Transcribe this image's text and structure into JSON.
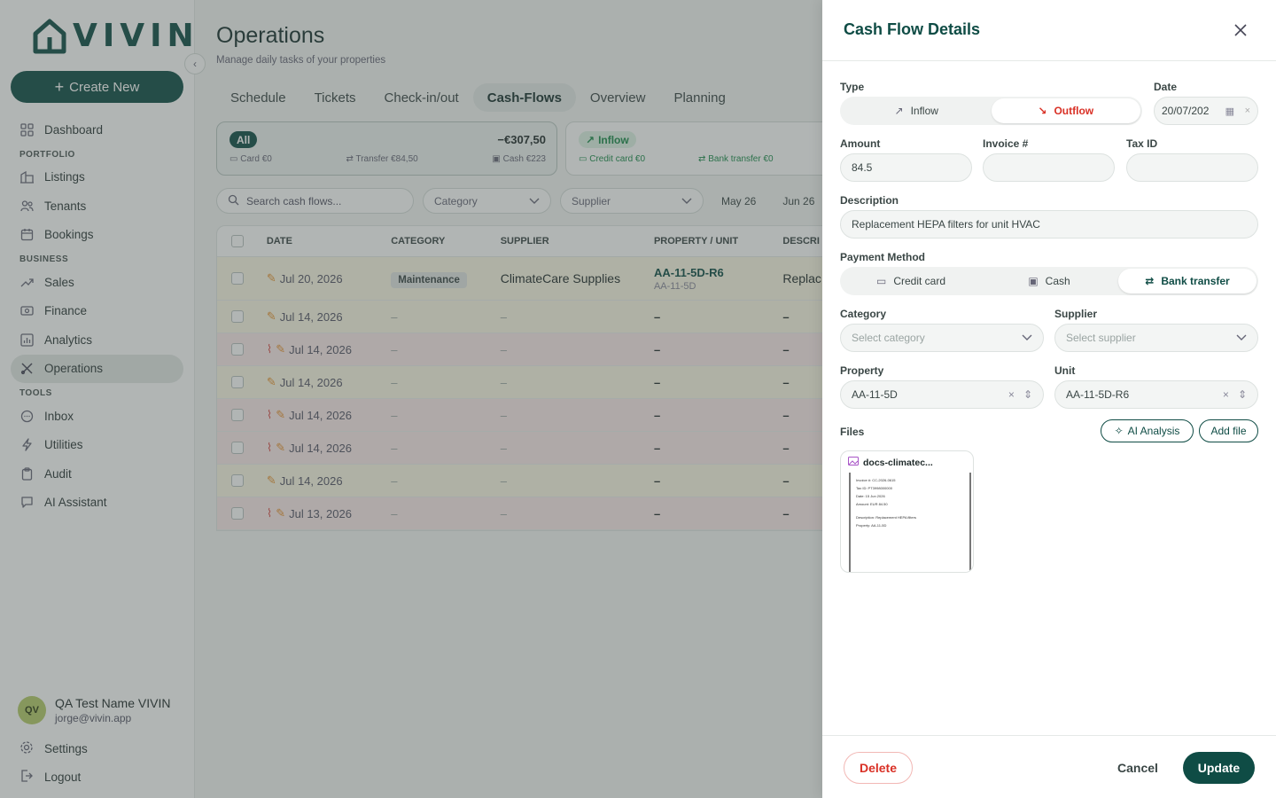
{
  "brand": {
    "name": "VIVIN"
  },
  "sidebar": {
    "create_label": "Create New",
    "items": [
      {
        "label": "Dashboard"
      },
      {
        "section": "PORTFOLIO"
      },
      {
        "label": "Listings"
      },
      {
        "label": "Tenants"
      },
      {
        "label": "Bookings"
      },
      {
        "section": "BUSINESS"
      },
      {
        "label": "Sales"
      },
      {
        "label": "Finance"
      },
      {
        "label": "Analytics"
      },
      {
        "label": "Operations"
      },
      {
        "section": "TOOLS"
      },
      {
        "label": "Inbox"
      },
      {
        "label": "Utilities"
      },
      {
        "label": "Audit"
      },
      {
        "label": "AI Assistant"
      }
    ],
    "user": {
      "initials": "QV",
      "name": "QA Test Name VIVIN",
      "email": "jorge@vivin.app"
    },
    "settings_label": "Settings",
    "logout_label": "Logout"
  },
  "page": {
    "title": "Operations",
    "subtitle": "Manage daily tasks of your properties",
    "tabs": [
      "Schedule",
      "Tickets",
      "Check-in/out",
      "Cash-Flows",
      "Overview",
      "Planning"
    ],
    "active_tab": "Cash-Flows"
  },
  "summary": {
    "all": {
      "label": "All",
      "total": "−€307,50",
      "card": "Card €0",
      "transfer": "Transfer €84,50",
      "cash": "Cash €223"
    },
    "inflow": {
      "label": "Inflow",
      "card": "Credit card €0",
      "transfer": "Bank transfer €0"
    }
  },
  "filters": {
    "search_placeholder": "Search cash flows...",
    "category": "Category",
    "supplier": "Supplier",
    "date1": "May 26",
    "date2": "Jun 26"
  },
  "table": {
    "headers": {
      "date": "DATE",
      "category": "CATEGORY",
      "supplier": "SUPPLIER",
      "property": "PROPERTY / UNIT",
      "description": "DESCRI"
    },
    "rows": [
      {
        "date": "Jul 20, 2026",
        "category": "Maintenance",
        "supplier": "ClimateCare Supplies",
        "property": "AA-11-5D-R6",
        "unit": "AA-11-5D",
        "description": "Replac",
        "color": "yellow",
        "attachment": false
      },
      {
        "date": "Jul 14, 2026",
        "category": "–",
        "supplier": "–",
        "property": "–",
        "description": "–",
        "color": "yellow",
        "attachment": false
      },
      {
        "date": "Jul 14, 2026",
        "category": "–",
        "supplier": "–",
        "property": "–",
        "description": "–",
        "color": "red",
        "attachment": true
      },
      {
        "date": "Jul 14, 2026",
        "category": "–",
        "supplier": "–",
        "property": "–",
        "description": "–",
        "color": "yellow",
        "attachment": false
      },
      {
        "date": "Jul 14, 2026",
        "category": "–",
        "supplier": "–",
        "property": "–",
        "description": "–",
        "color": "red",
        "attachment": true
      },
      {
        "date": "Jul 14, 2026",
        "category": "–",
        "supplier": "–",
        "property": "–",
        "description": "–",
        "color": "red",
        "attachment": true
      },
      {
        "date": "Jul 14, 2026",
        "category": "–",
        "supplier": "–",
        "property": "–",
        "description": "–",
        "color": "yellow",
        "attachment": false
      },
      {
        "date": "Jul 13, 2026",
        "category": "–",
        "supplier": "–",
        "property": "–",
        "description": "–",
        "color": "red",
        "attachment": true
      }
    ]
  },
  "drawer": {
    "title": "Cash Flow Details",
    "type_label": "Type",
    "inflow": "Inflow",
    "outflow": "Outflow",
    "selected_type": "Outflow",
    "date_label": "Date",
    "date_value": "20/07/202",
    "amount_label": "Amount",
    "amount_value": "84.5",
    "invoice_label": "Invoice #",
    "invoice_value": "",
    "taxid_label": "Tax ID",
    "taxid_value": "",
    "description_label": "Description",
    "description_value": "Replacement HEPA filters for unit HVAC",
    "payment_label": "Payment Method",
    "payment_options": [
      "Credit card",
      "Cash",
      "Bank transfer"
    ],
    "selected_payment": "Bank transfer",
    "category_label": "Category",
    "category_placeholder": "Select category",
    "supplier_label": "Supplier",
    "supplier_placeholder": "Select supplier",
    "property_label": "Property",
    "property_value": "AA-11-5D",
    "unit_label": "Unit",
    "unit_value": "AA-11-5D-R6",
    "files_label": "Files",
    "ai_analysis": "AI Analysis",
    "add_file": "Add file",
    "file": {
      "name": "docs-climatec...",
      "lines": [
        "Invoice #: CC-2026-0615",
        "Tax ID: PT3998000000",
        "Date: 15 Jun 2026",
        "Amount: EUR 84.50",
        "Description: Replacement HEPA filters",
        "Property: AA-11-5D"
      ]
    },
    "delete": "Delete",
    "cancel": "Cancel",
    "update": "Update"
  },
  "colors": {
    "brand": "#0f4c45",
    "danger": "#d93025",
    "inflow": "#1a8a4a"
  }
}
